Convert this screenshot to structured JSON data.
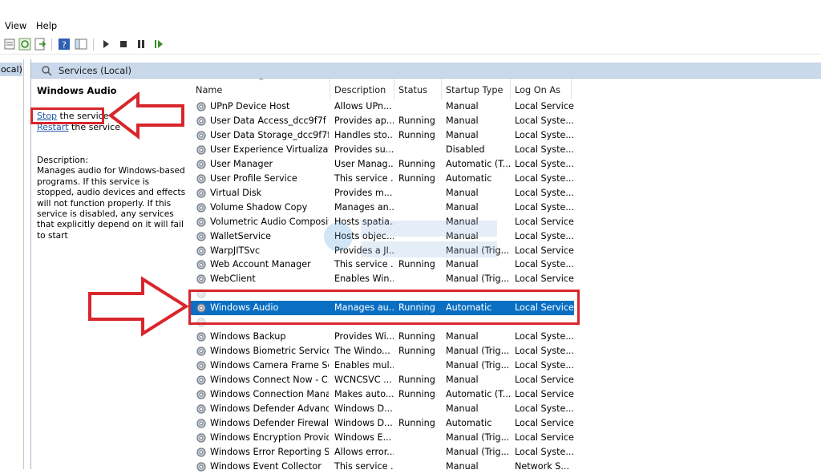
{
  "menu": {
    "view": "View",
    "help": "Help"
  },
  "left_strip": {
    "label": "ocal)"
  },
  "panel": {
    "title": "Services (Local)"
  },
  "extended": {
    "service_name": "Windows Audio",
    "stop_link": "Stop",
    "stop_rest": " the service",
    "restart_link": "Restart",
    "restart_rest": " the service",
    "description_label": "Description:",
    "description": "Manages audio for Windows-based programs.  If this service is stopped, audio devices and effects will not function properly.  If this service is disabled, any services that explicitly depend on it will fail to start"
  },
  "columns": {
    "name": "Name",
    "description": "Description",
    "status": "Status",
    "startup": "Startup Type",
    "logon": "Log On As"
  },
  "rows": [
    {
      "name": "UPnP Device Host",
      "desc": "Allows UPn...",
      "status": "",
      "startup": "Manual",
      "logon": "Local Service"
    },
    {
      "name": "User Data Access_dcc9f7f",
      "desc": "Provides ap...",
      "status": "Running",
      "startup": "Manual",
      "logon": "Local Syste..."
    },
    {
      "name": "User Data Storage_dcc9f7f",
      "desc": "Handles sto...",
      "status": "Running",
      "startup": "Manual",
      "logon": "Local Syste..."
    },
    {
      "name": "User Experience Virtualizati...",
      "desc": "Provides su...",
      "status": "",
      "startup": "Disabled",
      "logon": "Local Syste..."
    },
    {
      "name": "User Manager",
      "desc": "User Manag...",
      "status": "Running",
      "startup": "Automatic (T...",
      "logon": "Local Syste..."
    },
    {
      "name": "User Profile Service",
      "desc": "This service ...",
      "status": "Running",
      "startup": "Automatic",
      "logon": "Local Syste..."
    },
    {
      "name": "Virtual Disk",
      "desc": "Provides m...",
      "status": "",
      "startup": "Manual",
      "logon": "Local Syste..."
    },
    {
      "name": "Volume Shadow Copy",
      "desc": "Manages an...",
      "status": "",
      "startup": "Manual",
      "logon": "Local Syste..."
    },
    {
      "name": "Volumetric Audio Composit...",
      "desc": "Hosts spatia...",
      "status": "",
      "startup": "Manual",
      "logon": "Local Service"
    },
    {
      "name": "WalletService",
      "desc": "Hosts objec...",
      "status": "",
      "startup": "Manual",
      "logon": "Local Syste..."
    },
    {
      "name": "WarpJITSvc",
      "desc": "Provides a JI...",
      "status": "",
      "startup": "Manual (Trig...",
      "logon": "Local Service"
    },
    {
      "name": "Web Account Manager",
      "desc": "This service ...",
      "status": "Running",
      "startup": "Manual",
      "logon": "Local Syste..."
    },
    {
      "name": "WebClient",
      "desc": "Enables Win...",
      "status": "",
      "startup": "Manual (Trig...",
      "logon": "Local Service"
    },
    {
      "name": "",
      "desc": "",
      "status": "",
      "startup": "",
      "logon": ""
    },
    {
      "name": "Windows Audio",
      "desc": "Manages au...",
      "status": "Running",
      "startup": "Automatic",
      "logon": "Local Service",
      "selected": true
    },
    {
      "name": "",
      "desc": "",
      "status": "",
      "startup": "",
      "logon": ""
    },
    {
      "name": "Windows Backup",
      "desc": "Provides Wi...",
      "status": "Running",
      "startup": "Manual",
      "logon": "Local Syste..."
    },
    {
      "name": "Windows Biometric Service",
      "desc": "The Windo...",
      "status": "Running",
      "startup": "Manual (Trig...",
      "logon": "Local Syste..."
    },
    {
      "name": "Windows Camera Frame Se...",
      "desc": "Enables mul...",
      "status": "",
      "startup": "Manual (Trig...",
      "logon": "Local Syste..."
    },
    {
      "name": "Windows Connect Now - C...",
      "desc": "WCNCSVC ...",
      "status": "Running",
      "startup": "Manual",
      "logon": "Local Service"
    },
    {
      "name": "Windows Connection Mana...",
      "desc": "Makes auto...",
      "status": "Running",
      "startup": "Automatic (T...",
      "logon": "Local Service"
    },
    {
      "name": "Windows Defender Advanc...",
      "desc": "Windows D...",
      "status": "",
      "startup": "Manual",
      "logon": "Local Syste..."
    },
    {
      "name": "Windows Defender Firewall",
      "desc": "Windows D...",
      "status": "Running",
      "startup": "Automatic",
      "logon": "Local Service"
    },
    {
      "name": "Windows Encryption Provid...",
      "desc": "Windows E...",
      "status": "",
      "startup": "Manual (Trig...",
      "logon": "Local Service"
    },
    {
      "name": "Windows Error Reporting Se...",
      "desc": "Allows error...",
      "status": "",
      "startup": "Manual (Trig...",
      "logon": "Local Syste..."
    },
    {
      "name": "Windows Event Collector",
      "desc": "This service ...",
      "status": "",
      "startup": "Manual",
      "logon": "Network S..."
    }
  ],
  "colors": {
    "selection": "#0a6fc2",
    "highlight_red": "#d8262c",
    "header_blue": "#c9d8ea",
    "link": "#1f56a7"
  }
}
